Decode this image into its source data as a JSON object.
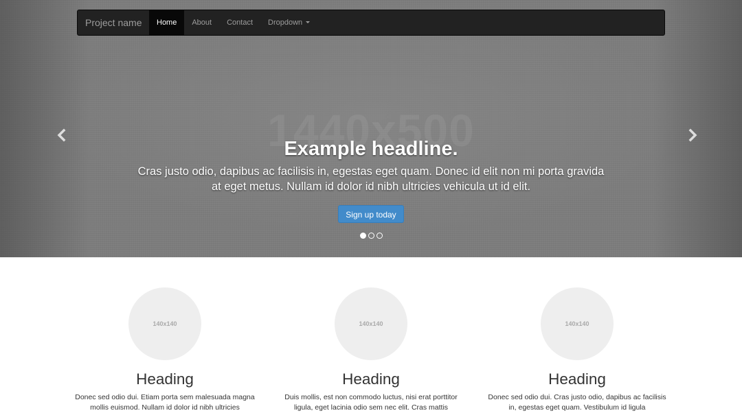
{
  "navbar": {
    "brand": "Project name",
    "items": [
      {
        "label": "Home",
        "active": true
      },
      {
        "label": "About",
        "active": false
      },
      {
        "label": "Contact",
        "active": false
      },
      {
        "label": "Dropdown",
        "active": false,
        "has_caret": true
      }
    ]
  },
  "carousel": {
    "placeholder": "1440x500",
    "headline": "Example headline.",
    "text": "Cras justo odio, dapibus ac facilisis in, egestas eget quam. Donec id elit non mi porta gravida at eget metus. Nullam id dolor id nibh ultricies vehicula ut id elit.",
    "button": "Sign up today",
    "left_icon": "chevron-left-icon",
    "right_icon": "chevron-right-icon",
    "slide_count": 3,
    "active_slide": 1
  },
  "marketing": {
    "columns": [
      {
        "image": "140x140",
        "heading": "Heading",
        "text": "Donec sed odio dui. Etiam porta sem malesuada magna mollis euismod. Nullam id dolor id nibh ultricies"
      },
      {
        "image": "140x140",
        "heading": "Heading",
        "text": "Duis mollis, est non commodo luctus, nisi erat porttitor ligula, eget lacinia odio sem nec elit. Cras mattis"
      },
      {
        "image": "140x140",
        "heading": "Heading",
        "text": "Donec sed odio dui. Cras justo odio, dapibus ac facilisis in, egestas eget quam. Vestibulum id ligula"
      }
    ]
  },
  "colors": {
    "navbar_bg": "#222222",
    "navbar_active_bg": "#080808",
    "button_primary": "#428bca",
    "thumbnail_bg": "#eeeeee"
  }
}
